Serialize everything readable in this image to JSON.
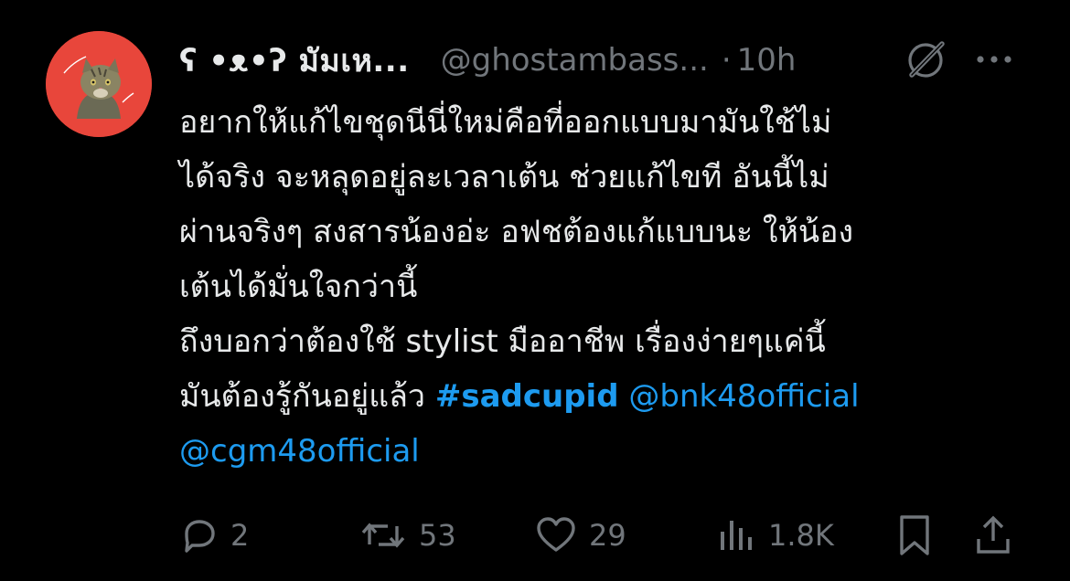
{
  "post": {
    "display_name": "ʕ •ᴥ•ʔ มัมเห...",
    "handle": "@ghostambass...",
    "separator": "·",
    "time": "10h",
    "avatar": {
      "background_color": "#e8463b",
      "icon": "cat-avatar-icon"
    },
    "body_lines": [
      [
        {
          "text": "อยากให้แก้ไขชุดนีนี่ใหม่คือที่ออกแบบมามันใช้ไม่",
          "kind": "text"
        }
      ],
      [
        {
          "text": "ได้จริง จะหลุดอยู่ละเวลาเต้น ช่วยแก้ไขที อันนี้ไม่",
          "kind": "text"
        }
      ],
      [
        {
          "text": "ผ่านจริงๆ สงสารน้องอ่ะ อฟชต้องแก้แบบนะ ให้น้อง",
          "kind": "text"
        }
      ],
      [
        {
          "text": "เต้นได้มั่นใจกว่านี้",
          "kind": "text"
        }
      ],
      [
        {
          "text": "ถึงบอกว่าต้องใช้ stylist มืออาชีพ เรื่องง่ายๆแค่นี้",
          "kind": "text"
        }
      ],
      [
        {
          "text": "มันต้องรู้กันอยู่แล้ว ",
          "kind": "text"
        },
        {
          "text": "#sadcupid",
          "kind": "hashtag"
        },
        {
          "text": " ",
          "kind": "text"
        },
        {
          "text": "@bnk48official",
          "kind": "mention"
        }
      ],
      [
        {
          "text": "@cgm48official",
          "kind": "mention"
        }
      ]
    ],
    "header_icons": {
      "grok": "grok-icon",
      "more": "more-icon"
    }
  },
  "actions": {
    "reply": {
      "icon": "reply-icon",
      "count": "2"
    },
    "repost": {
      "icon": "repost-icon",
      "count": "53"
    },
    "like": {
      "icon": "heart-icon",
      "count": "29"
    },
    "views": {
      "icon": "views-icon",
      "count": "1.8K"
    },
    "bookmark": {
      "icon": "bookmark-icon"
    },
    "share": {
      "icon": "share-icon"
    }
  },
  "colors": {
    "background": "#000000",
    "text_primary": "#e7e9ea",
    "text_secondary": "#71767b",
    "link": "#1d9bf0"
  }
}
